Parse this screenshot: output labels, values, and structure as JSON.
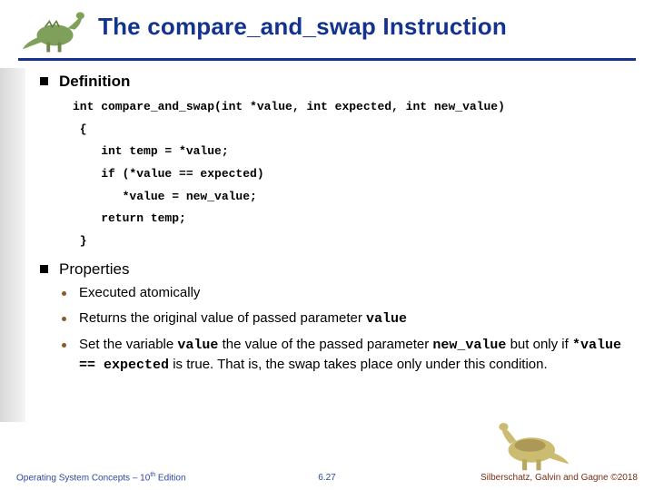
{
  "title": "The compare_and_swap  Instruction",
  "sections": {
    "definition": {
      "heading": "Definition",
      "code": [
        "int compare_and_swap(int *value, int expected, int new_value)",
        " {",
        "    int temp = *value;",
        "    if (*value == expected)",
        "       *value = new_value;",
        "    return temp;",
        " }"
      ]
    },
    "properties": {
      "heading": "Properties",
      "items": {
        "atomic": "Executed atomically",
        "returns_pre": "Returns the original value of passed parameter ",
        "returns_code": "value",
        "set_pre": "Set  the variable ",
        "set_code1": "value",
        "set_mid1": " the value of the passed parameter ",
        "set_code2": "new_value",
        "set_mid2": " but only if ",
        "set_code3": "*value == expected",
        "set_post": "  is true. That is, the swap takes place only under this condition."
      }
    }
  },
  "footer": {
    "left_pre": "Operating System Concepts – 10",
    "left_sup": "th",
    "left_post": " Edition",
    "center": "6.27",
    "right": "Silberschatz, Galvin and Gagne ©2018"
  }
}
